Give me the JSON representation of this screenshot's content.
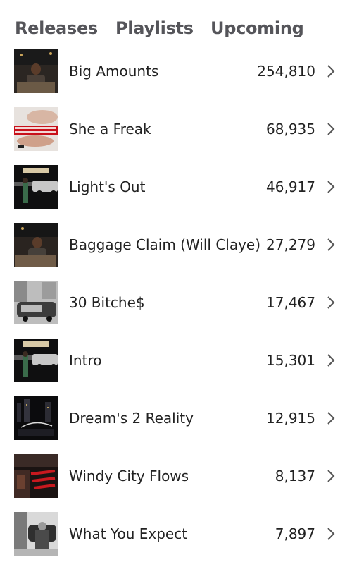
{
  "tabs": [
    {
      "label": "Releases"
    },
    {
      "label": "Playlists"
    },
    {
      "label": "Upcoming"
    }
  ],
  "tracks": [
    {
      "title": "Big Amounts",
      "streams": "254,810"
    },
    {
      "title": "She a Freak",
      "streams": "68,935"
    },
    {
      "title": "Light's Out",
      "streams": "46,917"
    },
    {
      "title": "Baggage Claim (Will Claye)",
      "streams": "27,279"
    },
    {
      "title": "30 Bitche$",
      "streams": "17,467"
    },
    {
      "title": "Intro",
      "streams": "15,301"
    },
    {
      "title": "Dream's 2 Reality",
      "streams": "12,915"
    },
    {
      "title": "Windy City Flows",
      "streams": "8,137"
    },
    {
      "title": "What You Expect",
      "streams": "7,897"
    }
  ],
  "icons": {
    "row_action": "chevron-right-icon"
  },
  "colors": {
    "tab_text": "#55555a",
    "text": "#222222",
    "chevron": "#555555"
  }
}
